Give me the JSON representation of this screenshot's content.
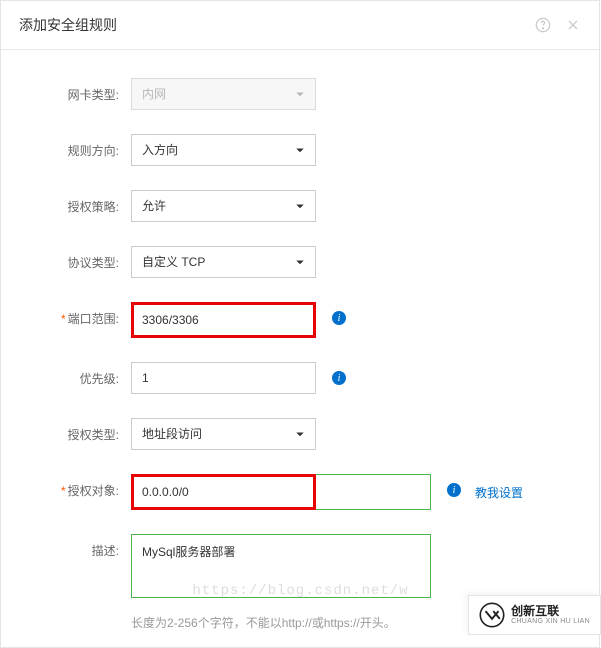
{
  "dialog": {
    "title": "添加安全组规则"
  },
  "form": {
    "nic_type": {
      "label": "网卡类型:",
      "value": "内网"
    },
    "direction": {
      "label": "规则方向:",
      "value": "入方向"
    },
    "auth_policy": {
      "label": "授权策略:",
      "value": "允许"
    },
    "protocol": {
      "label": "协议类型:",
      "value": "自定义 TCP"
    },
    "port_range": {
      "label": "端口范围:",
      "value": "3306/3306"
    },
    "priority": {
      "label": "优先级:",
      "value": "1"
    },
    "auth_type": {
      "label": "授权类型:",
      "value": "地址段访问"
    },
    "auth_object": {
      "label": "授权对象:",
      "value": "0.0.0.0/0",
      "help_link": "教我设置"
    },
    "description": {
      "label": "描述:",
      "value": "MySql服务器部署",
      "hint": "长度为2-256个字符，不能以http://或https://开头。"
    }
  },
  "watermark": "https://blog.csdn.net/w",
  "logo": {
    "cn": "创新互联",
    "en": "CHUANG XIN HU LIAN"
  }
}
